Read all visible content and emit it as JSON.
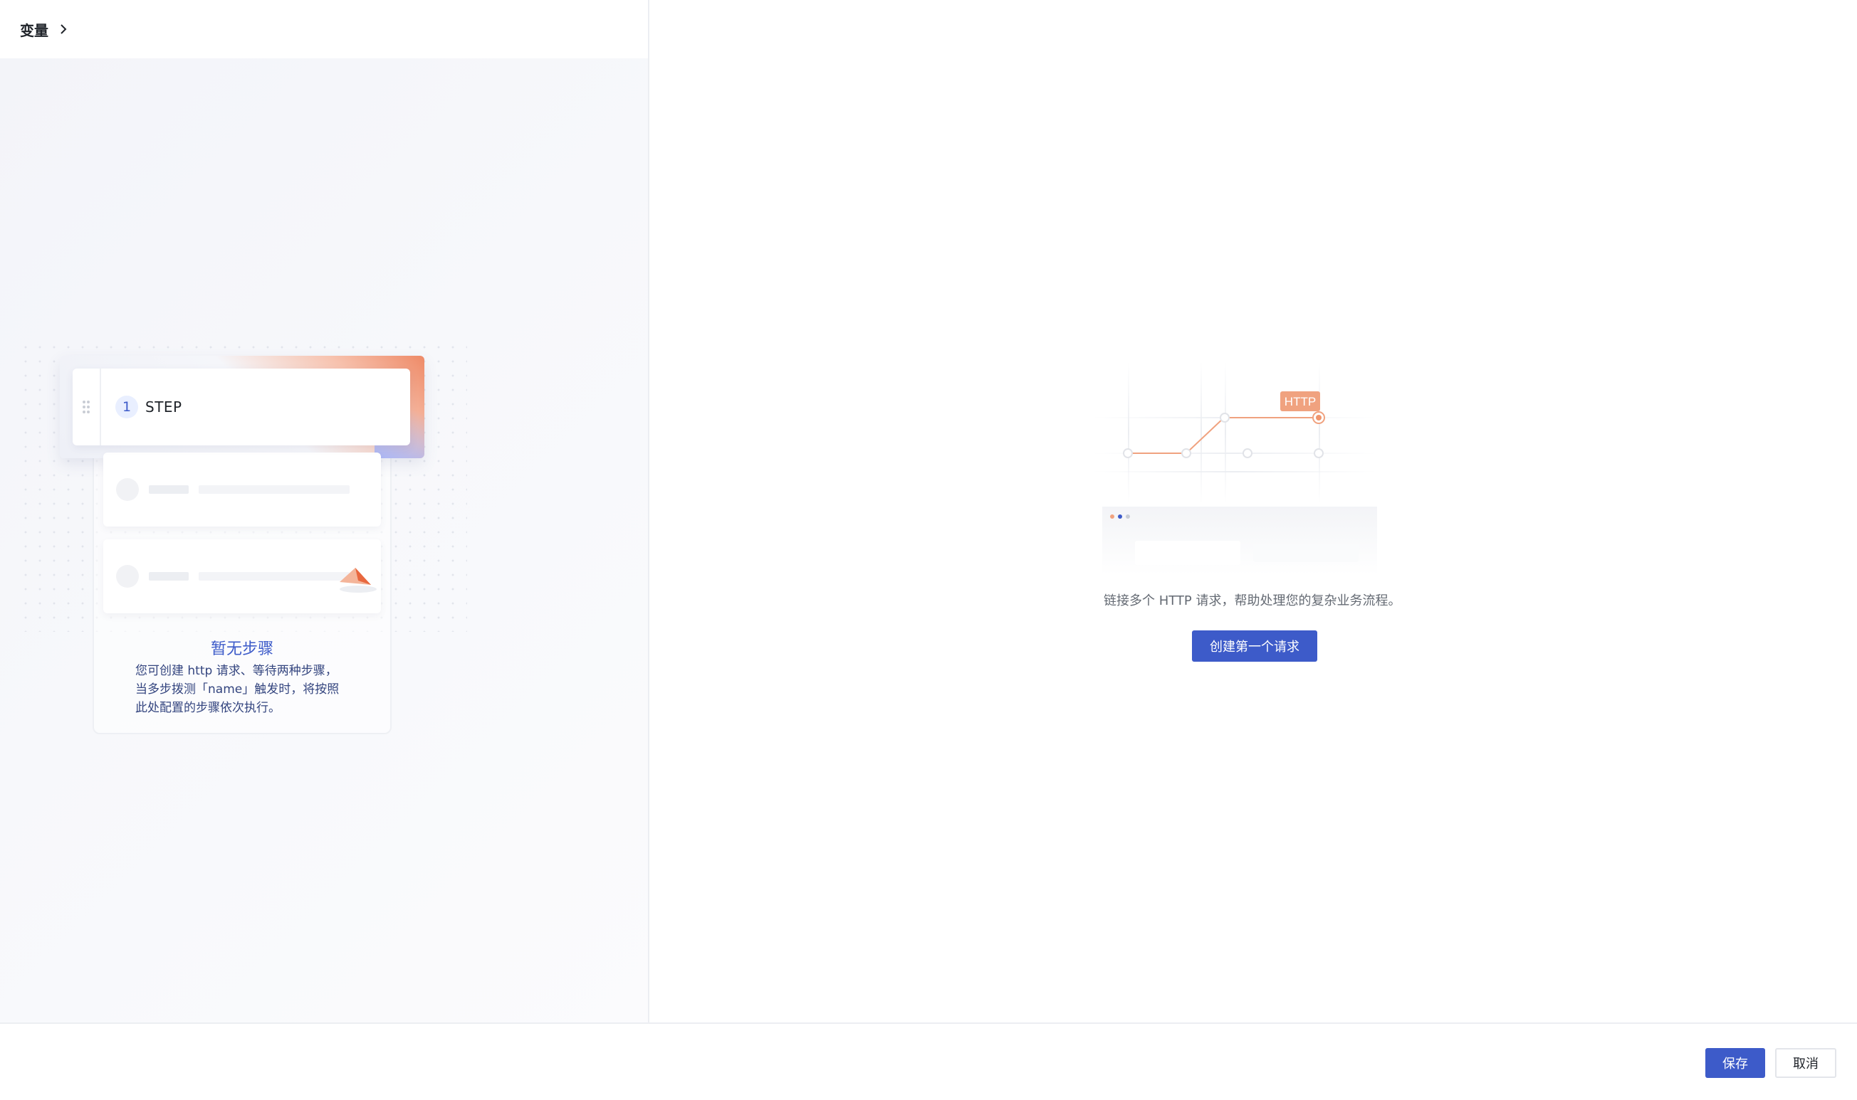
{
  "header": {
    "variables_label": "变量"
  },
  "steps_panel": {
    "active_step": {
      "number": "1",
      "label": "STEP"
    },
    "empty_title": "暂无步骤",
    "empty_description": "您可创建 http 请求、等待两种步骤， 当多步拨测「name」触发时，将按照此处配置的步骤依次执行。"
  },
  "detail_panel": {
    "illustration_badge": "HTTP",
    "description": "链接多个 HTTP 请求，帮助处理您的复杂业务流程。",
    "create_button_label": "创建第一个请求"
  },
  "footer": {
    "save_label": "保存",
    "cancel_label": "取消"
  },
  "colors": {
    "primary": "#3d5bc9",
    "accent_orange": "#f0956d",
    "border": "#eceef2"
  }
}
